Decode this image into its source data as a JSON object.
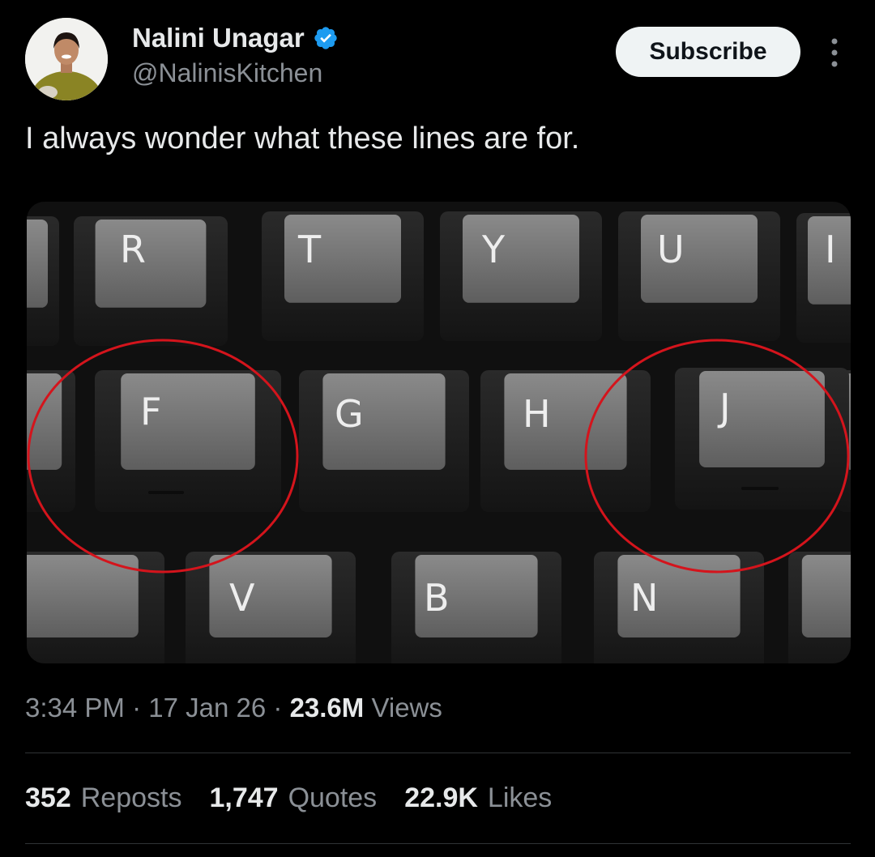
{
  "author": {
    "name": "Nalini Unagar",
    "handle": "@NalinisKitchen",
    "verified": true,
    "verified_color": "#1d9bf0"
  },
  "subscribe_label": "Subscribe",
  "tweet_text": "I always wonder what these lines are for.",
  "media": {
    "key_labels": [
      "R",
      "T",
      "Y",
      "U",
      "I",
      "F",
      "G",
      "H",
      "J",
      "V",
      "B",
      "N"
    ],
    "highlight_color": "#d4141c"
  },
  "meta": {
    "time": "3:34 PM",
    "separator": "·",
    "date": "17 Jan 26",
    "views_count": "23.6M",
    "views_label": "Views"
  },
  "stats": [
    {
      "count": "352",
      "label": "Reposts"
    },
    {
      "count": "1,747",
      "label": "Quotes"
    },
    {
      "count": "22.9K",
      "label": "Likes"
    }
  ],
  "icons": [
    "verified-badge-icon",
    "more-options-icon"
  ]
}
